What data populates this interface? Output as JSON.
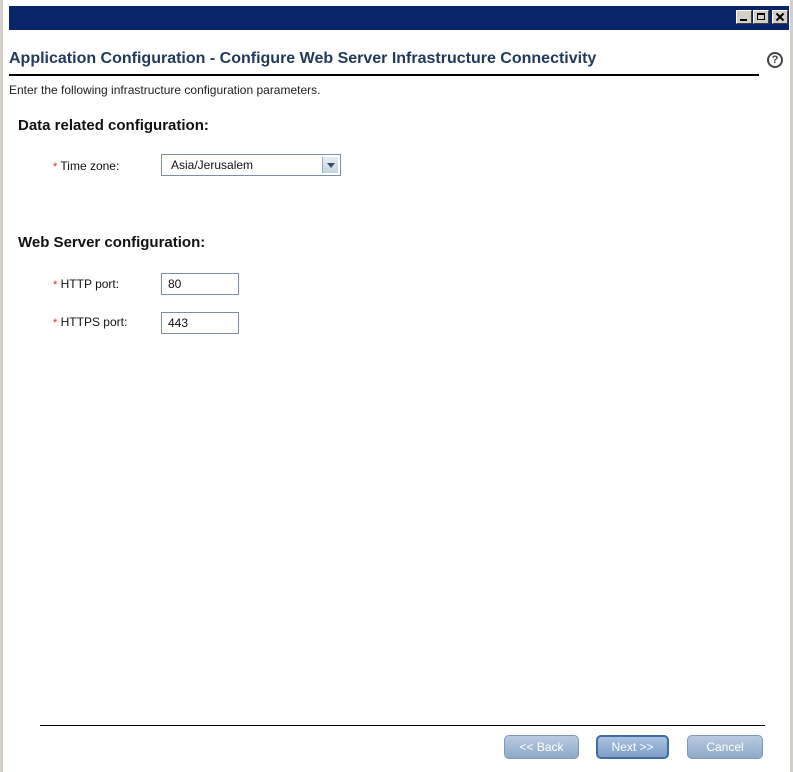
{
  "window": {
    "controls": [
      "minimize-icon",
      "maximize-icon",
      "close-icon"
    ]
  },
  "header": {
    "title": "Application Configuration - Configure Web Server Infrastructure Connectivity",
    "help_symbol": "?"
  },
  "intro": "Enter the following infrastructure configuration parameters.",
  "required_marker": "*",
  "data_section": {
    "heading": "Data related configuration:",
    "time_zone_label": "Time zone:",
    "time_zone_value": "Asia/Jerusalem"
  },
  "web_section": {
    "heading": "Web Server configuration:",
    "http_label": "HTTP port:",
    "http_value": "80",
    "https_label": "HTTPS port:",
    "https_value": "443"
  },
  "buttons": {
    "back": "<< Back",
    "next": "Next >>",
    "cancel": "Cancel"
  },
  "colors": {
    "titlebar": "#0a246a",
    "title_text": "#223a5e",
    "required": "#dd2222",
    "button": "#8ea9c8"
  }
}
